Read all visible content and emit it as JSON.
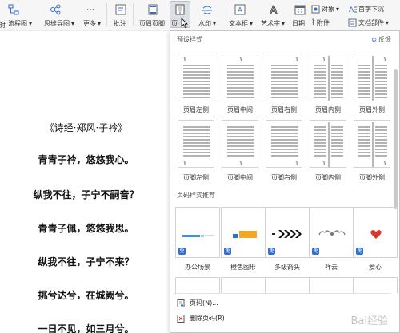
{
  "ribbon": {
    "btn_cut": "封",
    "btn_flowchart": "流程图",
    "btn_mindmap": "思维导图",
    "btn_more": "更多",
    "btn_comment": "批注",
    "btn_header_footer": "页眉页脚",
    "btn_page_number": "页",
    "btn_watermark": "水印",
    "btn_textbox": "文本框",
    "btn_wordart": "艺术字",
    "btn_date": "日期",
    "btn_object": "对象",
    "btn_attachment": "附件",
    "btn_dropcap": "首字下沉",
    "btn_docparts": "文档部件"
  },
  "document": {
    "title": "《诗经·郑风·子衿》",
    "verses": [
      "青青子衿，悠悠我心。",
      "纵我不往，子宁不嗣音？",
      "青青子佩，悠悠我思。",
      "纵我不往，子宁不来？",
      "挑兮达兮，在城阙兮。",
      "一日不见，如三月兮。"
    ]
  },
  "panel": {
    "preset_title": "预设样式",
    "feedback": "反馈",
    "recommend_title": "页码样式推荐",
    "header_presets": [
      {
        "label": "页眉左侧",
        "num": "1",
        "style": "header-left"
      },
      {
        "label": "页眉中间",
        "num": "1",
        "style": "header-center"
      },
      {
        "label": "页眉右侧",
        "num": "1",
        "style": "header-right"
      },
      {
        "label": "页眉内侧",
        "num": "1",
        "style": "header-inner"
      },
      {
        "label": "页眉外侧",
        "num": "1",
        "style": "header-outer"
      }
    ],
    "footer_presets": [
      {
        "label": "页脚左侧",
        "num": "1",
        "style": "footer-left"
      },
      {
        "label": "页脚中间",
        "num": "1",
        "style": "footer-center"
      },
      {
        "label": "页脚右侧",
        "num": "1",
        "style": "footer-right"
      },
      {
        "label": "页脚内侧",
        "num": "1",
        "style": "footer-inner"
      },
      {
        "label": "页脚外侧",
        "num": "1",
        "style": "footer-outer"
      }
    ],
    "recommended": [
      {
        "label": "办公场景",
        "badge": "免"
      },
      {
        "label": "橙色图形",
        "badge": "免"
      },
      {
        "label": "多级箭头",
        "badge": "免"
      },
      {
        "label": "祥云",
        "badge": "免"
      },
      {
        "label": "爱心",
        "badge": "免"
      }
    ],
    "menu": {
      "page_number": "页码(N)...",
      "delete_page_number": "删除页码(R)"
    },
    "watermark_text": "Bai经验"
  },
  "colors": {
    "accent_blue": "#2f6fd0",
    "orange": "#f5a623",
    "heart_red": "#d9372b"
  }
}
